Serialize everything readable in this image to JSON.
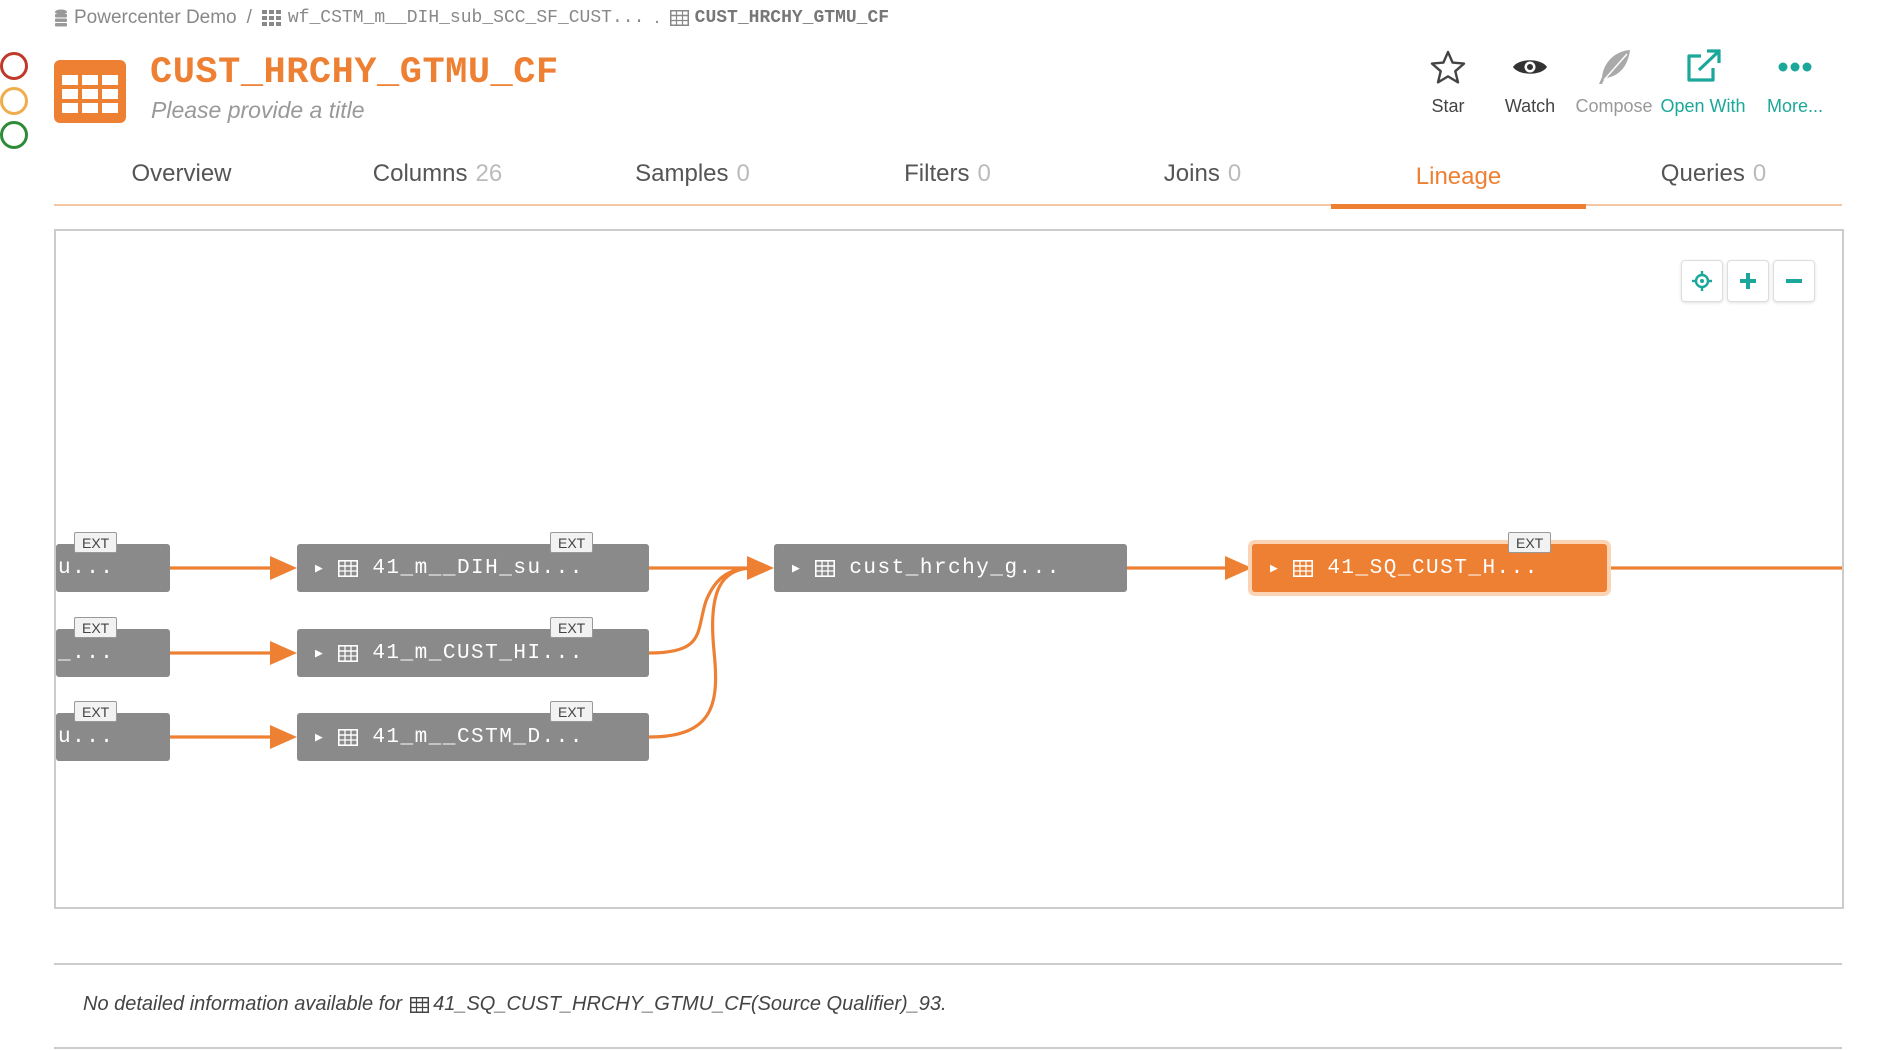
{
  "breadcrumb": {
    "source": "Powercenter Demo",
    "separator": "/",
    "workflow": "wf_CSTM_m__DIH_sub_SCC_SF_CUST...",
    "dot": ".",
    "current": "CUST_HRCHY_GTMU_CF"
  },
  "status_colors": [
    "#c0392b",
    "#f0ad4e",
    "#2e8b3a"
  ],
  "header": {
    "title": "CUST_HRCHY_GTMU_CF",
    "subtitle": "Please provide a title"
  },
  "actions": {
    "star": "Star",
    "watch": "Watch",
    "compose": "Compose",
    "open_with": "Open With",
    "more": "More..."
  },
  "tabs": [
    {
      "label": "Overview",
      "count": ""
    },
    {
      "label": "Columns",
      "count": "26"
    },
    {
      "label": "Samples",
      "count": "0"
    },
    {
      "label": "Filters",
      "count": "0"
    },
    {
      "label": "Joins",
      "count": "0"
    },
    {
      "label": "Lineage",
      "count": "",
      "active": true
    },
    {
      "label": "Queries",
      "count": "0"
    }
  ],
  "lineage": {
    "ext_label": "EXT",
    "left_nodes": [
      "u...",
      "_...",
      "u..."
    ],
    "mid_nodes": [
      "41_m__DIH_su...",
      "41_m_CUST_HI...",
      "41_m__CSTM_D..."
    ],
    "target_node": "cust_hrchy_g...",
    "selected_node": "41_SQ_CUST_H..."
  },
  "detail": {
    "prefix": "No detailed information available for",
    "entity": "41_SQ_CUST_HRCHY_GTMU_CF(Source Qualifier)_93."
  },
  "colors": {
    "accent": "#ee8034",
    "teal": "#1ba79a",
    "node_gray": "#8a8a8a"
  }
}
